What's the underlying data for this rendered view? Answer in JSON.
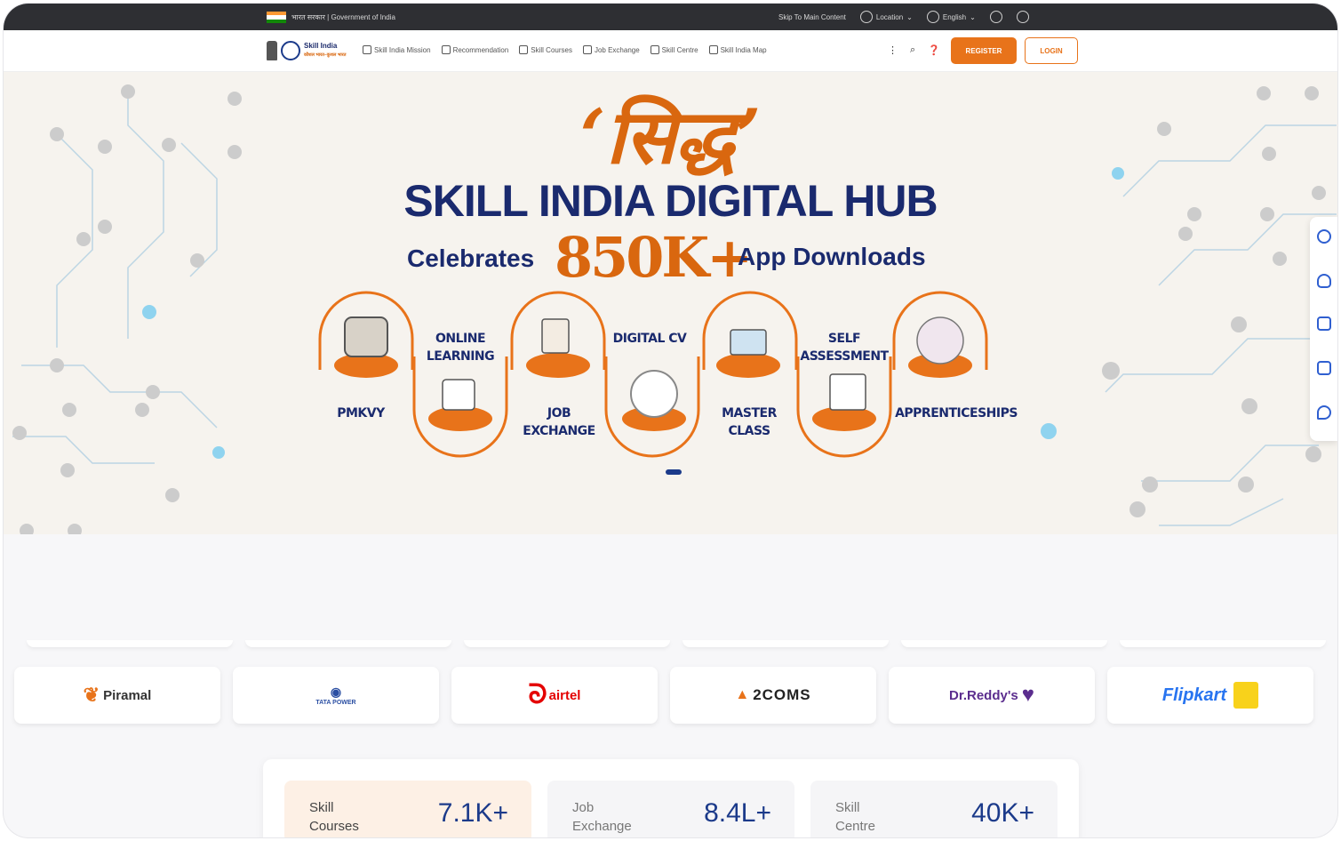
{
  "gov_bar": {
    "left_text": "भारत सरकार | Government of India",
    "skip": "Skip To Main Content",
    "location": "Location",
    "language": "English"
  },
  "header": {
    "logo_title": "Skill India",
    "logo_subtitle": "कौशल भारत–कुशल भारत",
    "nav_items": [
      "Skill India Mission",
      "Recommendation",
      "Skill Courses",
      "Job Exchange",
      "Skill Centre",
      "Skill India Map"
    ],
    "register": "REGISTER",
    "login": "LOGIN"
  },
  "hero": {
    "hindi_title": "‘सिद्ध’",
    "title": "SKILL INDIA DIGITAL HUB",
    "celebrates": "Celebrates",
    "big_number": "850K+",
    "downloads": "App Downloads",
    "features": [
      {
        "label": "PMKVY",
        "icon": "tools-icon"
      },
      {
        "label": "ONLINE LEARNING",
        "icon": "laptop-learning-icon"
      },
      {
        "label": "JOB EXCHANGE",
        "icon": "job-search-icon"
      },
      {
        "label": "DIGITAL CV",
        "icon": "document-cv-icon"
      },
      {
        "label": "MASTER CLASS",
        "icon": "presentation-icon"
      },
      {
        "label": "SELF ASSESSMENT",
        "icon": "checklist-icon"
      },
      {
        "label": "APPRENTICESHIPS",
        "icon": "graduates-icon"
      }
    ]
  },
  "side_rail": [
    "phone-icon",
    "bulb-icon",
    "calendar-icon",
    "gallery-icon",
    "chat-icon"
  ],
  "partners": [
    {
      "name": "Piramal",
      "color": "#333333"
    },
    {
      "name": "TATA POWER",
      "color": "#2b4fa3"
    },
    {
      "name": "airtel",
      "color": "#e40000"
    },
    {
      "name": "2COMS",
      "color": "#222222"
    },
    {
      "name": "Dr.Reddy's",
      "color": "#5b2d8e"
    },
    {
      "name": "Flipkart",
      "color": "#2874f0"
    }
  ],
  "stats": [
    {
      "label": "Skill Courses",
      "value": "7.1K+",
      "highlight": true
    },
    {
      "label": "Job Exchange",
      "value": "8.4L+",
      "highlight": false
    },
    {
      "label": "Skill Centre",
      "value": "40K+",
      "highlight": false
    }
  ],
  "colors": {
    "brand_orange": "#e8731a",
    "brand_navy": "#1a2a6e"
  }
}
